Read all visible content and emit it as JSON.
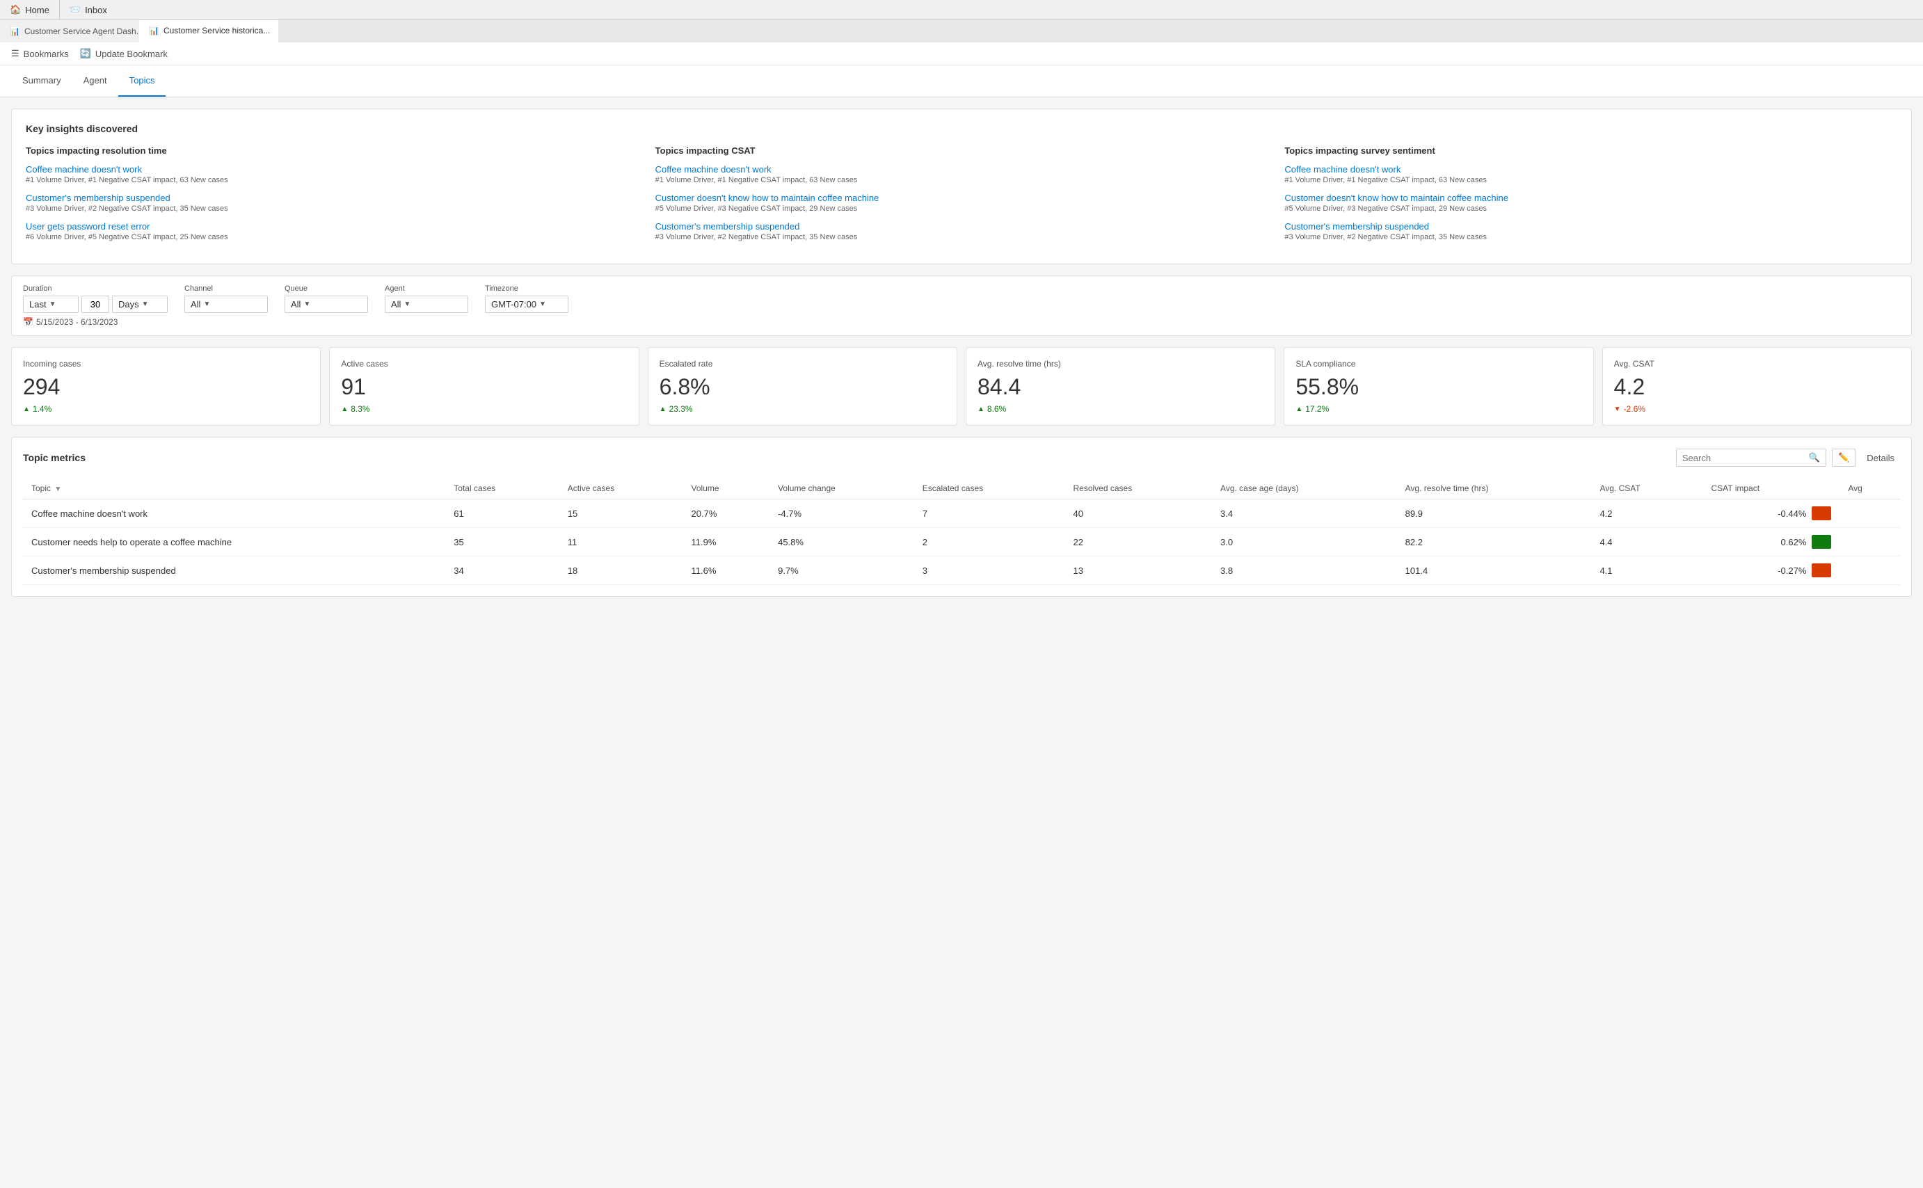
{
  "browser": {
    "tabs": [
      {
        "id": "home",
        "label": "Home",
        "icon": "🏠",
        "active": false
      },
      {
        "id": "inbox",
        "label": "Inbox",
        "icon": "📨",
        "active": false
      }
    ],
    "document_tabs": [
      {
        "id": "agent-dash",
        "label": "Customer Service Agent Dash...",
        "icon": "📊",
        "active": false
      },
      {
        "id": "historical",
        "label": "Customer Service historica...",
        "icon": "📊",
        "active": true,
        "closable": true
      }
    ]
  },
  "toolbar": {
    "bookmarks_label": "Bookmarks",
    "update_bookmark_label": "Update Bookmark"
  },
  "nav": {
    "tabs": [
      {
        "id": "summary",
        "label": "Summary",
        "active": false
      },
      {
        "id": "agent",
        "label": "Agent",
        "active": false
      },
      {
        "id": "topics",
        "label": "Topics",
        "active": true
      }
    ]
  },
  "insights": {
    "title": "Key insights discovered",
    "columns": [
      {
        "heading": "Topics impacting resolution time",
        "items": [
          {
            "link": "Coffee machine doesn't work",
            "meta": "#1 Volume Driver, #1 Negative CSAT impact, 63 New cases"
          },
          {
            "link": "Customer's membership suspended",
            "meta": "#3 Volume Driver, #2 Negative CSAT impact, 35 New cases"
          },
          {
            "link": "User gets password reset error",
            "meta": "#6 Volume Driver, #5 Negative CSAT impact, 25 New cases"
          }
        ]
      },
      {
        "heading": "Topics impacting CSAT",
        "items": [
          {
            "link": "Coffee machine doesn't work",
            "meta": "#1 Volume Driver, #1 Negative CSAT impact, 63 New cases"
          },
          {
            "link": "Customer doesn't know how to maintain coffee machine",
            "meta": "#5 Volume Driver, #3 Negative CSAT impact, 29 New cases"
          },
          {
            "link": "Customer's membership suspended",
            "meta": "#3 Volume Driver, #2 Negative CSAT impact, 35 New cases"
          }
        ]
      },
      {
        "heading": "Topics impacting survey sentiment",
        "items": [
          {
            "link": "Coffee machine doesn't work",
            "meta": "#1 Volume Driver, #1 Negative CSAT impact, 63 New cases"
          },
          {
            "link": "Customer doesn't know how to maintain coffee machine",
            "meta": "#5 Volume Driver, #3 Negative CSAT impact, 29 New cases"
          },
          {
            "link": "Customer's membership suspended",
            "meta": "#3 Volume Driver, #2 Negative CSAT impact, 35 New cases"
          }
        ]
      }
    ]
  },
  "filters": {
    "duration_label": "Duration",
    "duration_preset": "Last",
    "duration_value": "30",
    "duration_unit": "Days",
    "channel_label": "Channel",
    "channel_value": "All",
    "queue_label": "Queue",
    "queue_value": "All",
    "agent_label": "Agent",
    "agent_value": "All",
    "timezone_label": "Timezone",
    "timezone_value": "GMT-07:00",
    "date_range": "5/15/2023 - 6/13/2023"
  },
  "kpis": [
    {
      "title": "Incoming cases",
      "value": "294",
      "change": "1.4%",
      "direction": "up"
    },
    {
      "title": "Active cases",
      "value": "91",
      "change": "8.3%",
      "direction": "up"
    },
    {
      "title": "Escalated rate",
      "value": "6.8%",
      "change": "23.3%",
      "direction": "up"
    },
    {
      "title": "Avg. resolve time (hrs)",
      "value": "84.4",
      "change": "8.6%",
      "direction": "up"
    },
    {
      "title": "SLA compliance",
      "value": "55.8%",
      "change": "17.2%",
      "direction": "up"
    },
    {
      "title": "Avg. CSAT",
      "value": "4.2",
      "change": "-2.6%",
      "direction": "down"
    }
  ],
  "table": {
    "title": "Topic metrics",
    "search_placeholder": "Search",
    "details_label": "Details",
    "columns": [
      "Topic",
      "Total cases",
      "Active cases",
      "Volume",
      "Volume change",
      "Escalated cases",
      "Resolved cases",
      "Avg. case age (days)",
      "Avg. resolve time (hrs)",
      "Avg. CSAT",
      "CSAT impact",
      "Avg"
    ],
    "rows": [
      {
        "topic": "Coffee machine doesn't work",
        "total_cases": "61",
        "active_cases": "15",
        "volume": "20.7%",
        "volume_change": "-4.7%",
        "escalated": "7",
        "resolved": "40",
        "avg_case_age": "3.4",
        "avg_resolve_time": "89.9",
        "avg_csat": "4.2",
        "csat_impact": "-0.44%",
        "csat_bar": "red"
      },
      {
        "topic": "Customer needs help to operate a coffee machine",
        "total_cases": "35",
        "active_cases": "11",
        "volume": "11.9%",
        "volume_change": "45.8%",
        "escalated": "2",
        "resolved": "22",
        "avg_case_age": "3.0",
        "avg_resolve_time": "82.2",
        "avg_csat": "4.4",
        "csat_impact": "0.62%",
        "csat_bar": "green"
      },
      {
        "topic": "Customer's membership suspended",
        "total_cases": "34",
        "active_cases": "18",
        "volume": "11.6%",
        "volume_change": "9.7%",
        "escalated": "3",
        "resolved": "13",
        "avg_case_age": "3.8",
        "avg_resolve_time": "101.4",
        "avg_csat": "4.1",
        "csat_impact": "-0.27%",
        "csat_bar": "red"
      }
    ]
  }
}
